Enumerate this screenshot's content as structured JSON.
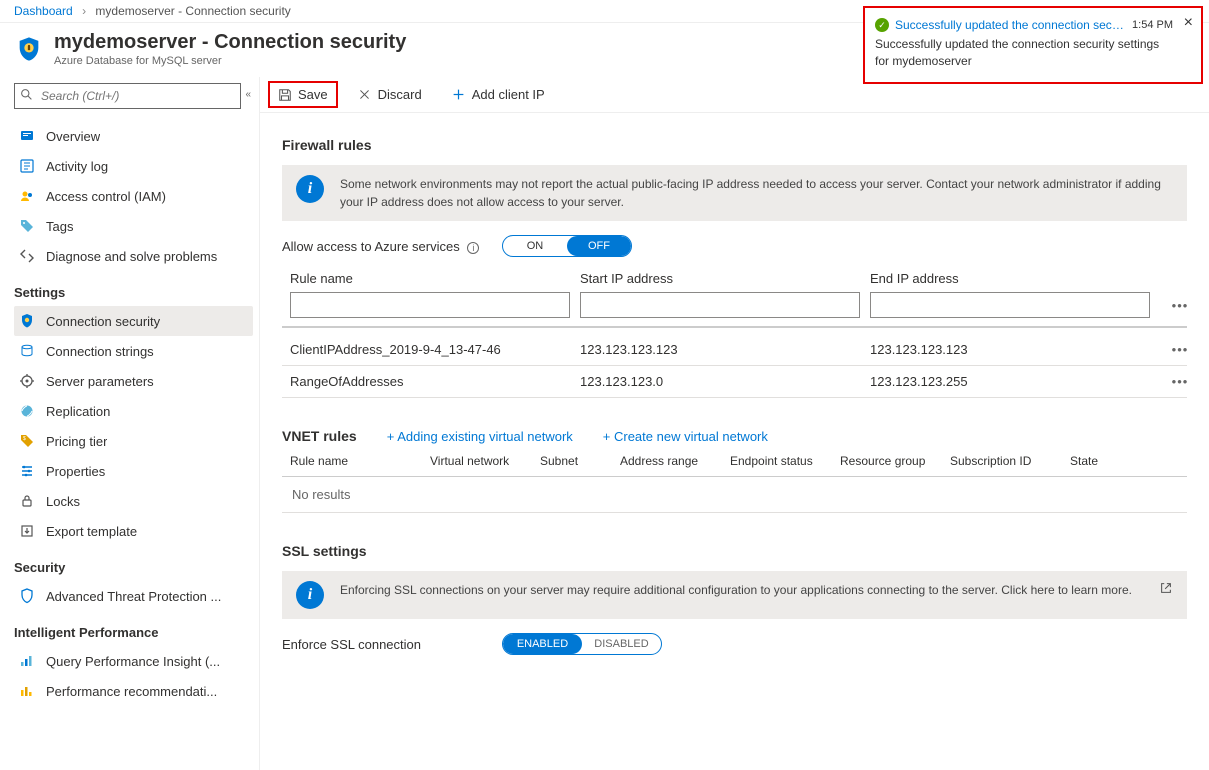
{
  "breadcrumb": {
    "root": "Dashboard",
    "current": "mydemoserver - Connection security"
  },
  "header": {
    "title": "mydemoserver - Connection security",
    "subtitle": "Azure Database for MySQL server"
  },
  "search": {
    "placeholder": "Search (Ctrl+/)"
  },
  "sidebar": {
    "top": [
      {
        "label": "Overview",
        "icon": "overview"
      },
      {
        "label": "Activity log",
        "icon": "activity"
      },
      {
        "label": "Access control (IAM)",
        "icon": "iam"
      },
      {
        "label": "Tags",
        "icon": "tags"
      },
      {
        "label": "Diagnose and solve problems",
        "icon": "diagnose"
      }
    ],
    "groups": [
      {
        "title": "Settings",
        "items": [
          {
            "label": "Connection security",
            "icon": "shield",
            "active": true
          },
          {
            "label": "Connection strings",
            "icon": "strings"
          },
          {
            "label": "Server parameters",
            "icon": "params"
          },
          {
            "label": "Replication",
            "icon": "replication"
          },
          {
            "label": "Pricing tier",
            "icon": "pricing"
          },
          {
            "label": "Properties",
            "icon": "properties"
          },
          {
            "label": "Locks",
            "icon": "locks"
          },
          {
            "label": "Export template",
            "icon": "export"
          }
        ]
      },
      {
        "title": "Security",
        "items": [
          {
            "label": "Advanced Threat Protection ...",
            "icon": "atp"
          }
        ]
      },
      {
        "title": "Intelligent Performance",
        "items": [
          {
            "label": "Query Performance Insight (...",
            "icon": "qpi"
          },
          {
            "label": "Performance recommendati...",
            "icon": "perf"
          }
        ]
      }
    ]
  },
  "toolbar": {
    "save": "Save",
    "discard": "Discard",
    "addClientIp": "Add client IP"
  },
  "firewall": {
    "title": "Firewall rules",
    "info": "Some network environments may not report the actual public-facing IP address needed to access your server.  Contact your network administrator if adding your IP address does not allow access to your server.",
    "allowAzureLabel": "Allow access to Azure services",
    "toggle": {
      "on": "ON",
      "off": "OFF"
    },
    "headers": {
      "name": "Rule name",
      "start": "Start IP address",
      "end": "End IP address"
    },
    "rules": [
      {
        "name": "ClientIPAddress_2019-9-4_13-47-46",
        "start": "123.123.123.123",
        "end": "123.123.123.123"
      },
      {
        "name": "RangeOfAddresses",
        "start": "123.123.123.0",
        "end": "123.123.123.255"
      }
    ]
  },
  "vnet": {
    "title": "VNET rules",
    "addExisting": "+ Adding existing virtual network",
    "createNew": "+ Create new virtual network",
    "headers": [
      "Rule name",
      "Virtual network",
      "Subnet",
      "Address range",
      "Endpoint status",
      "Resource group",
      "Subscription ID",
      "State"
    ],
    "noResults": "No results"
  },
  "ssl": {
    "title": "SSL settings",
    "info": "Enforcing SSL connections on your server may require additional configuration to your applications connecting to the server.  Click here to learn more.",
    "enforceLabel": "Enforce SSL connection",
    "enabled": "ENABLED",
    "disabled": "DISABLED"
  },
  "notification": {
    "title": "Successfully updated the connection secur...",
    "time": "1:54 PM",
    "body": "Successfully updated the connection security settings for mydemoserver"
  }
}
